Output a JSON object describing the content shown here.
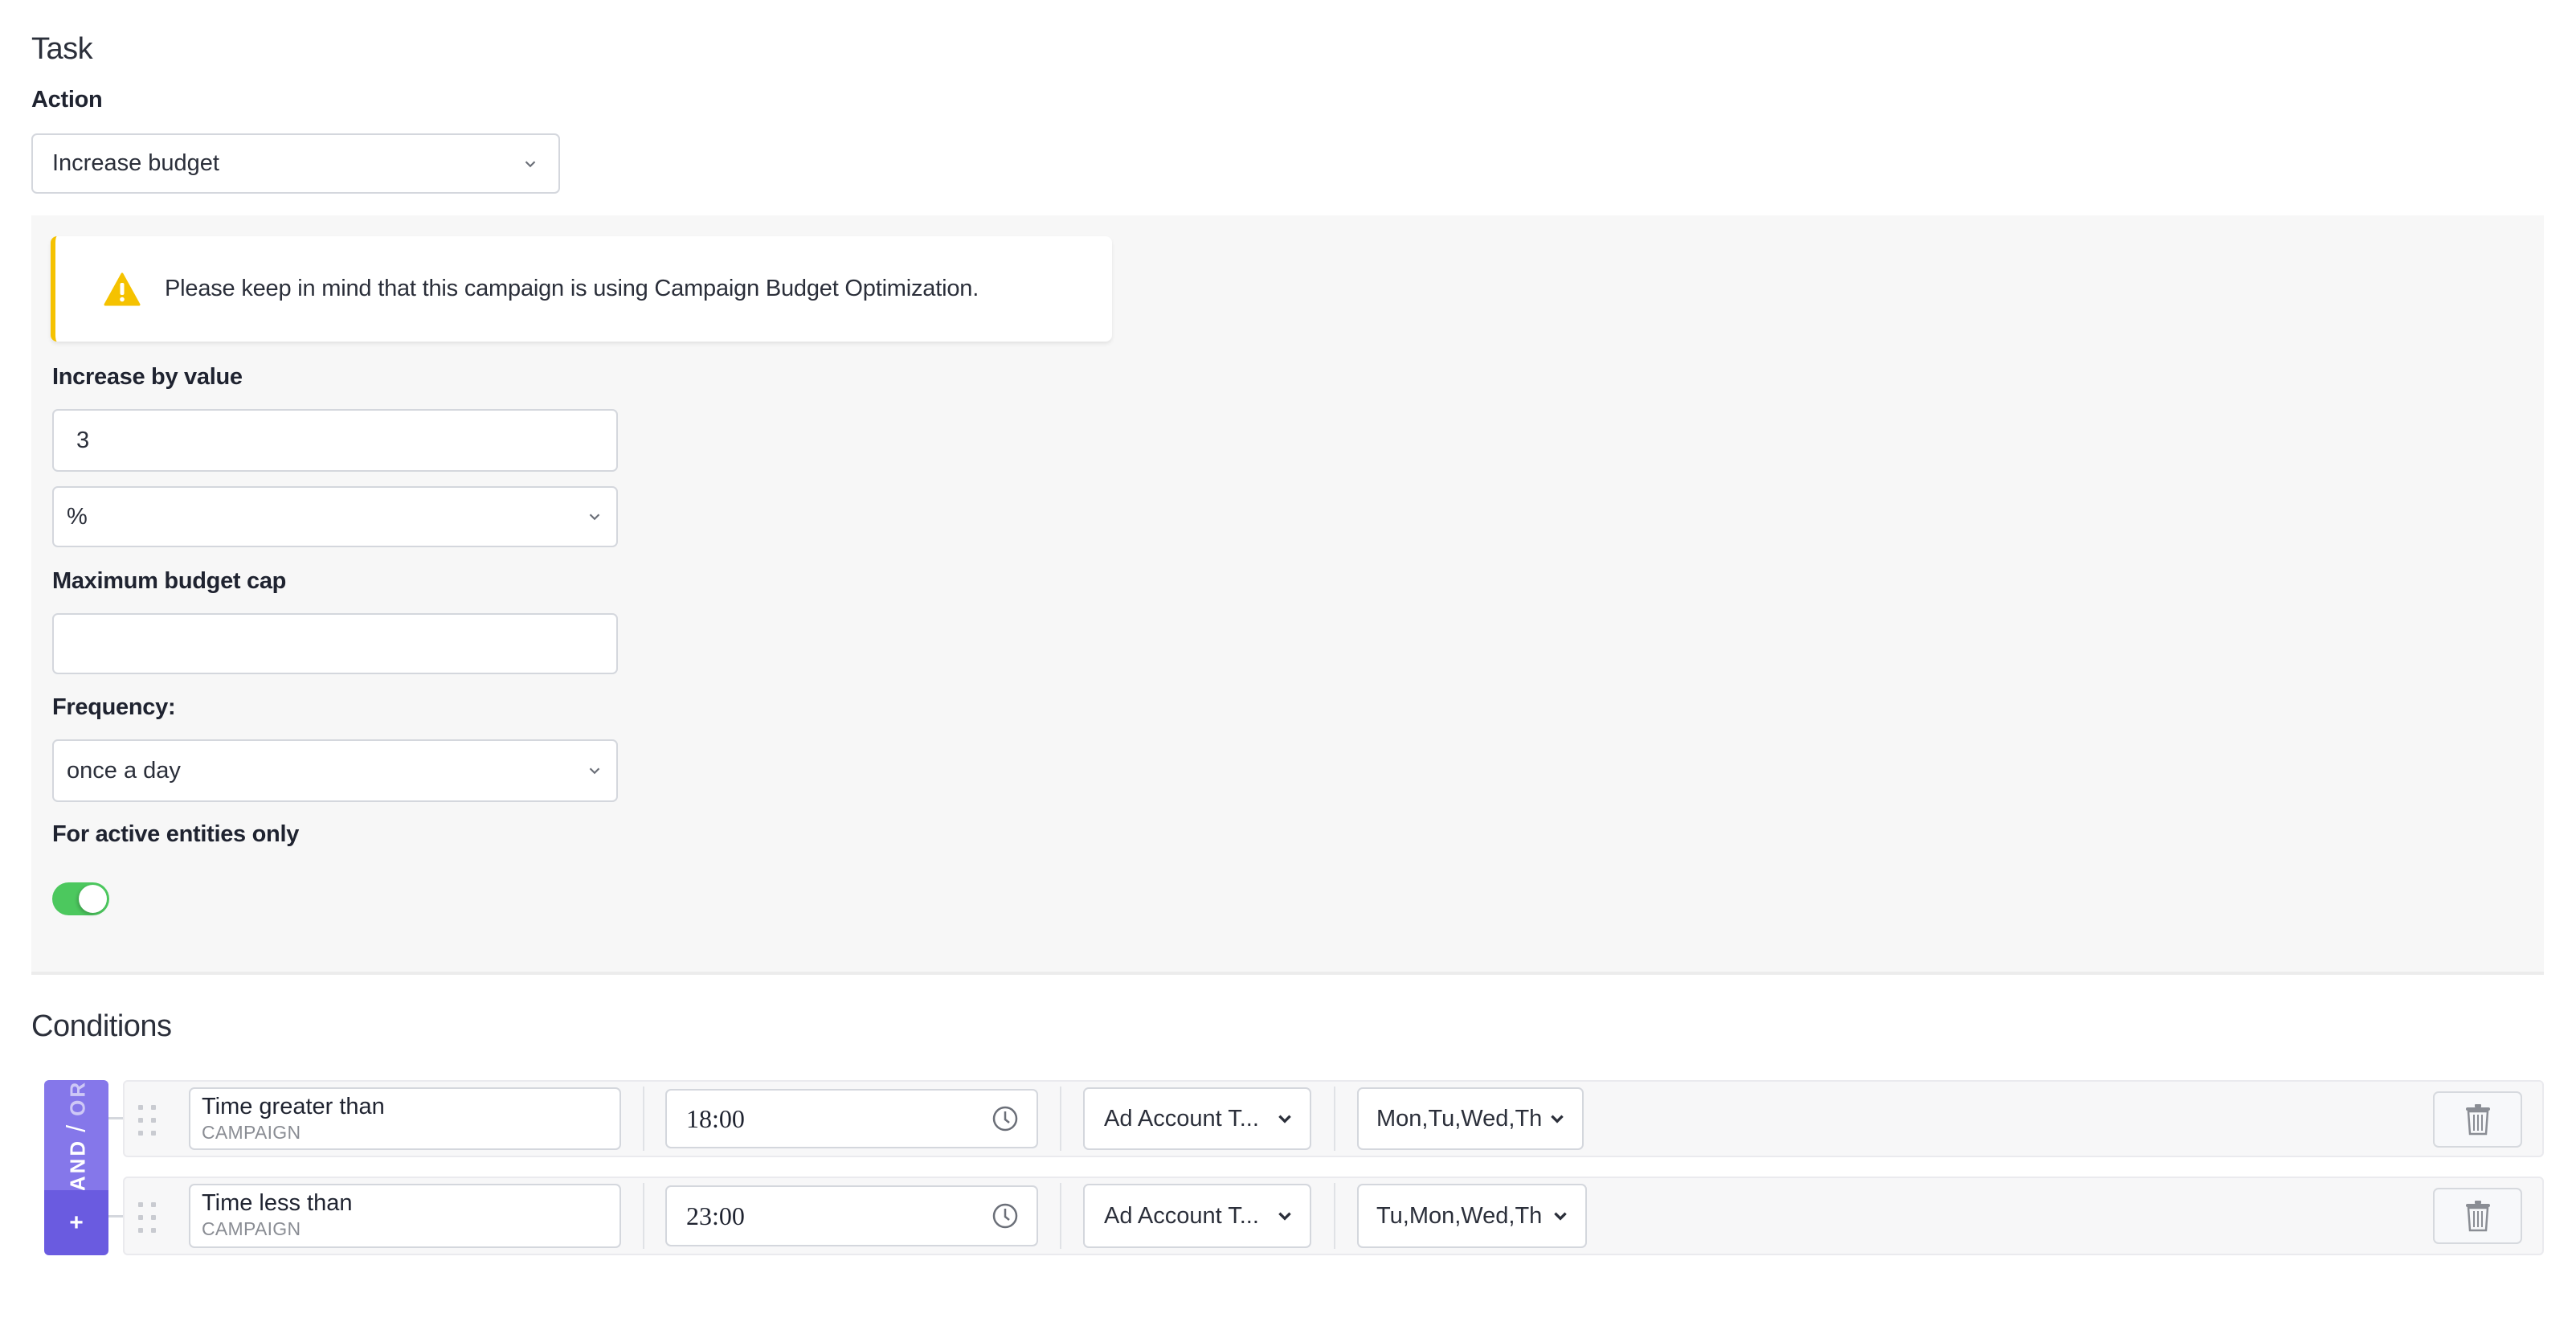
{
  "task": {
    "heading": "Task",
    "action_label": "Action",
    "action_value": "Increase budget",
    "warning": {
      "icon": "warning-triangle-icon",
      "message": "Please keep in mind that this campaign is using Campaign Budget Optimization.",
      "accent_color": "#f5c200"
    },
    "increase_by": {
      "label": "Increase by value",
      "value": "3",
      "unit_value": "%"
    },
    "max_budget_cap": {
      "label": "Maximum budget cap",
      "value": ""
    },
    "frequency": {
      "label": "Frequency:",
      "value": "once a day"
    },
    "active_only": {
      "label": "For active entities only",
      "enabled": true,
      "toggle_color": "#4cc85e"
    }
  },
  "conditions": {
    "heading": "Conditions",
    "logic": {
      "and_label": "AND",
      "slash": "/",
      "or_label": "OR",
      "add_label": "+",
      "colors": {
        "logic": "#8577ea",
        "add": "#6a5be0"
      }
    },
    "rows": [
      {
        "name": "Time greater than",
        "scope": "CAMPAIGN",
        "time": "18:00",
        "timezone_select": "Ad Account T...",
        "days_select": "Mon,Tu,Wed,Th"
      },
      {
        "name": "Time less than",
        "scope": "CAMPAIGN",
        "time": "23:00",
        "timezone_select": "Ad Account T...",
        "days_select": "Tu,Mon,Wed,Th"
      }
    ]
  }
}
